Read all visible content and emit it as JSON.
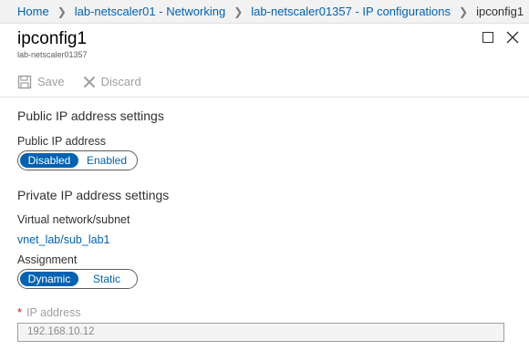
{
  "breadcrumb": {
    "items": [
      {
        "label": "Home"
      },
      {
        "label": "lab-netscaler01 - Networking"
      },
      {
        "label": "lab-netscaler01357 - IP configurations"
      }
    ],
    "current": "ipconfig1"
  },
  "blade": {
    "title": "ipconfig1",
    "subtitle": "lab-netscaler01357"
  },
  "commands": {
    "save_label": "Save",
    "discard_label": "Discard"
  },
  "public_ip": {
    "section_title": "Public IP address settings",
    "field_label": "Public IP address",
    "options": [
      "Disabled",
      "Enabled"
    ],
    "selected": "Disabled"
  },
  "private_ip": {
    "section_title": "Private IP address settings",
    "subnet_label": "Virtual network/subnet",
    "subnet_value": "vnet_lab/sub_lab1",
    "assignment_label": "Assignment",
    "assignment_options": [
      "Dynamic",
      "Static"
    ],
    "assignment_selected": "Dynamic",
    "ip_label": "IP address",
    "ip_value": "192.168.10.12"
  },
  "colors": {
    "accent": "#0062b1",
    "required": "#e00b1c",
    "disabled_text": "#a19f9d"
  }
}
